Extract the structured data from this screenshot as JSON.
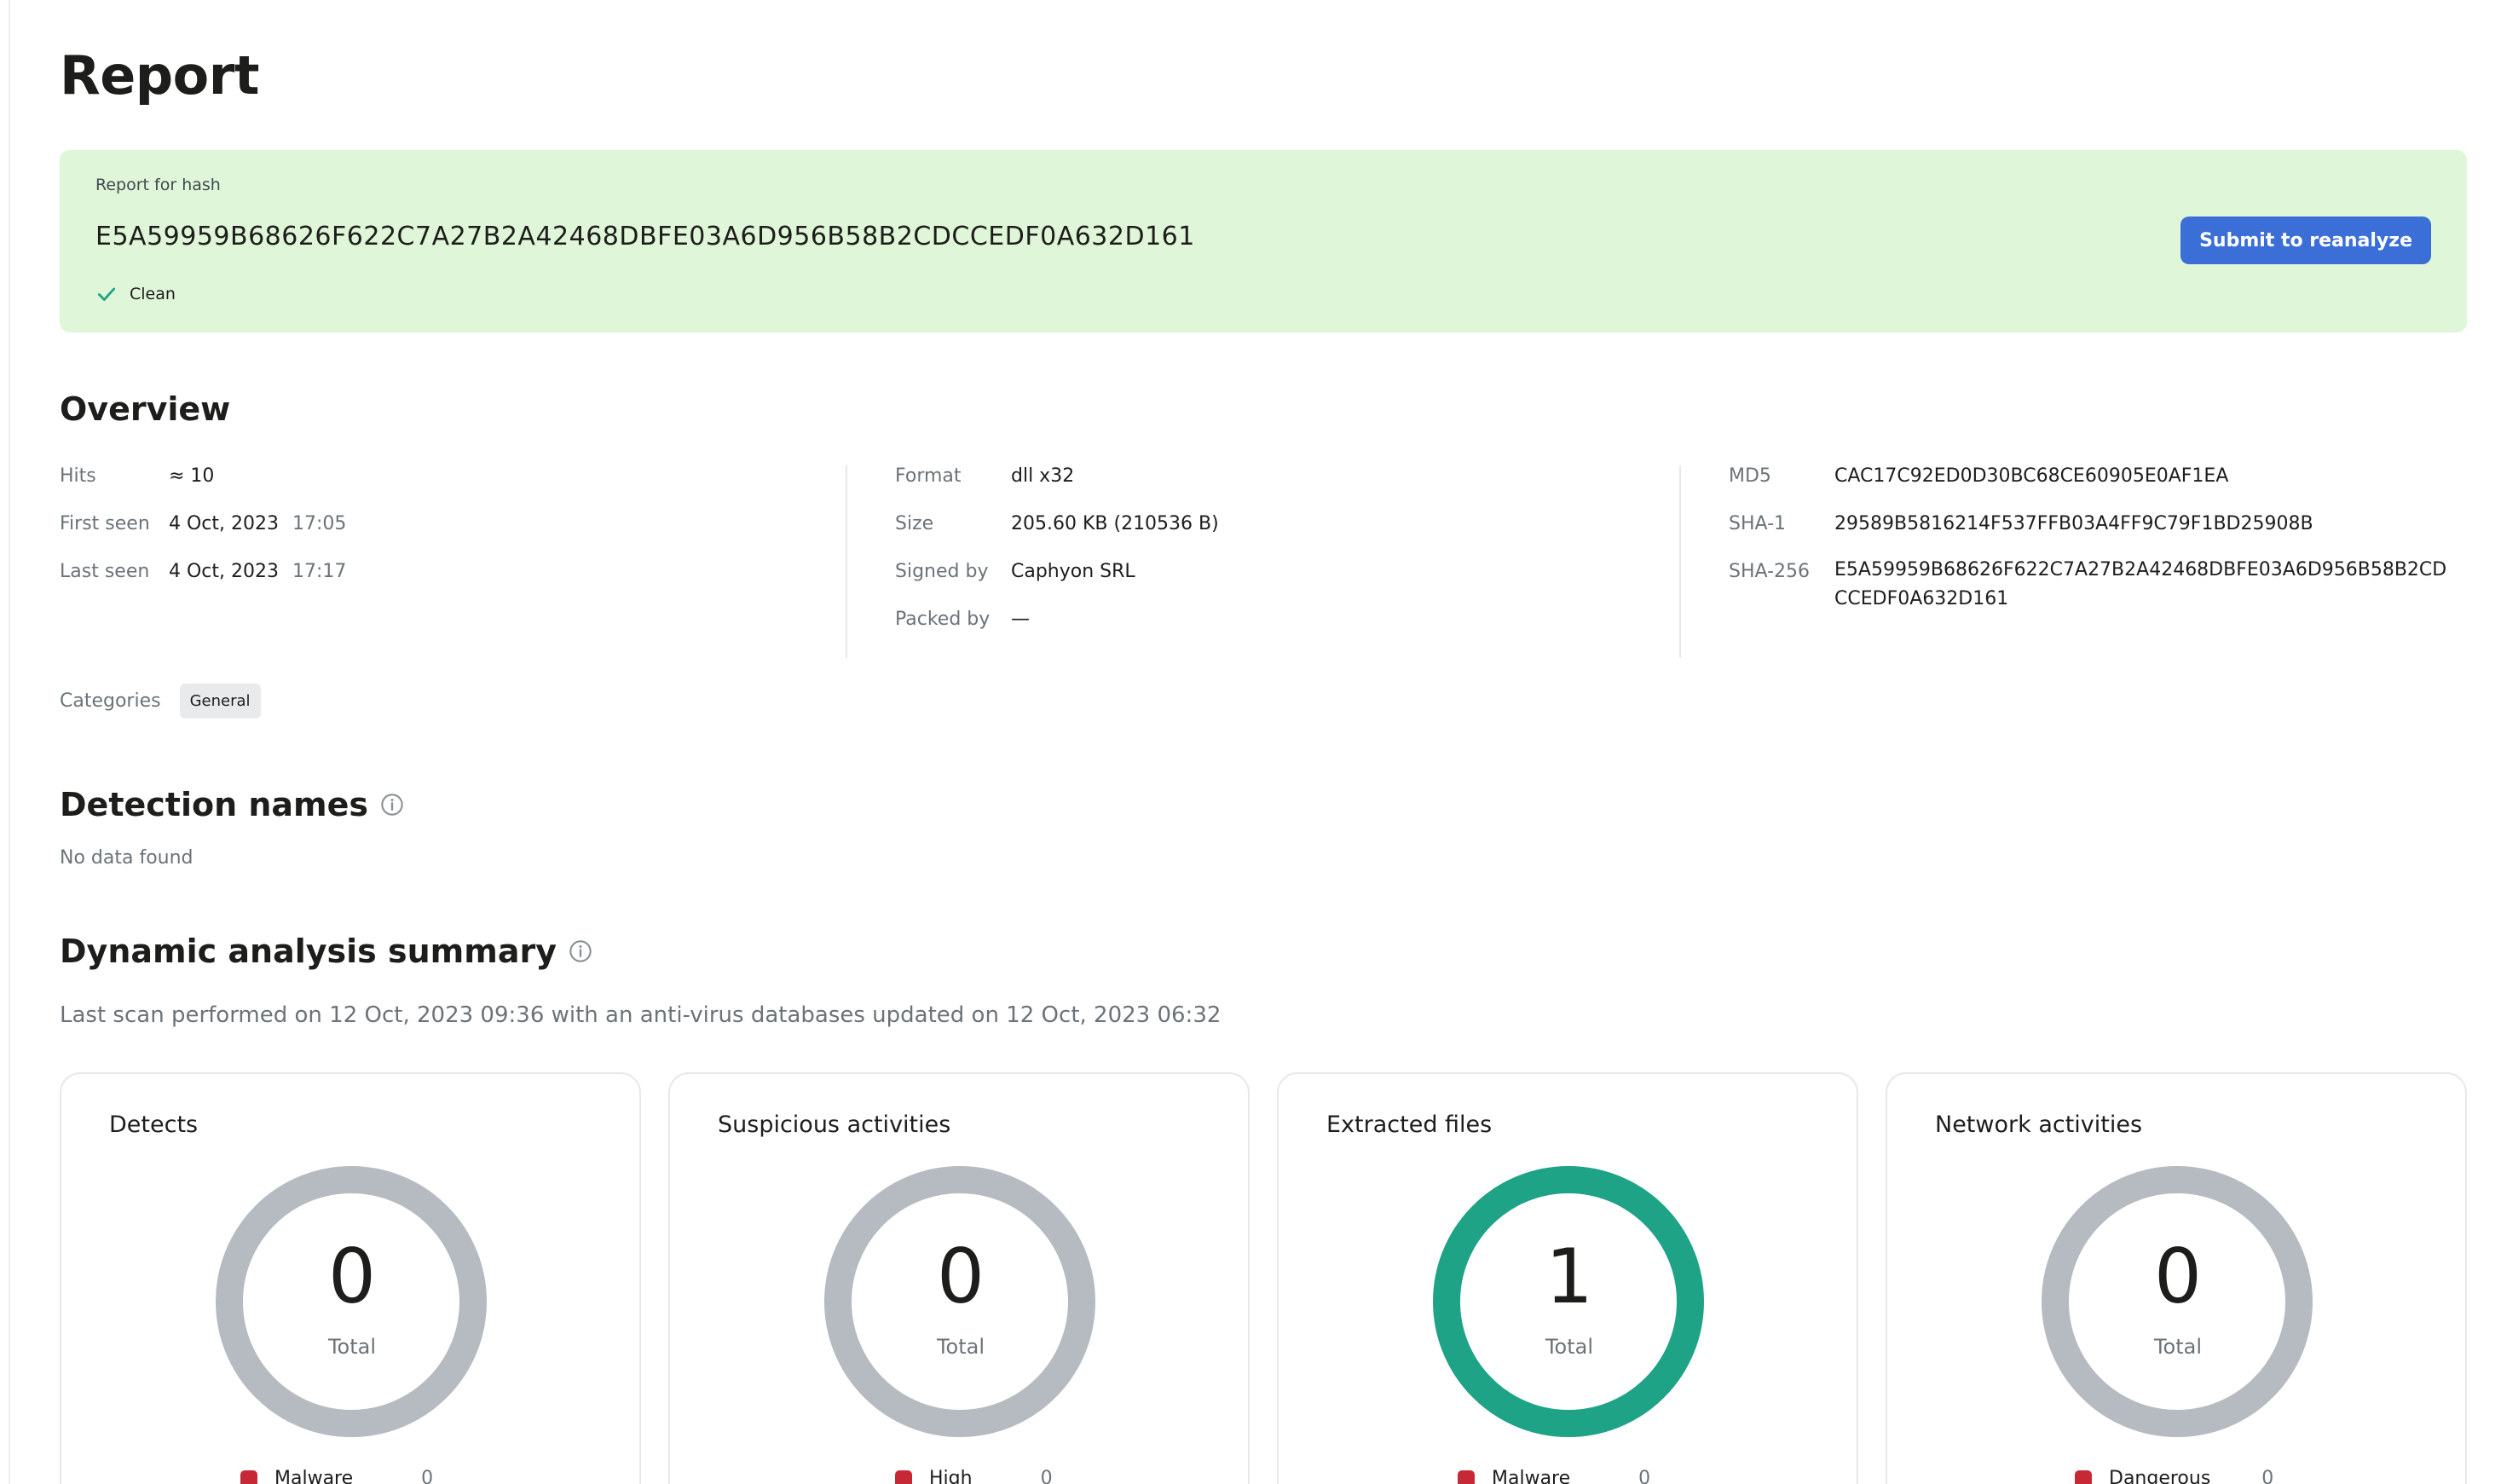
{
  "page": {
    "title": "Report"
  },
  "hash_banner": {
    "label": "Report for hash",
    "hash": "E5A59959B68626F622C7A27B2A42468DBFE03A6D956B58B2CDCCEDF0A632D161",
    "status": "Clean",
    "status_icon": "check-icon",
    "reanalyze_label": "Submit to reanalyze",
    "background_color": "#e0f6d8",
    "button_color": "#3b6fd7"
  },
  "overview": {
    "title": "Overview",
    "col1": [
      {
        "key": "Hits",
        "value": "≈ 10",
        "sub": ""
      },
      {
        "key": "First seen",
        "value": "4 Oct, 2023",
        "sub": "17:05"
      },
      {
        "key": "Last seen",
        "value": "4 Oct, 2023",
        "sub": "17:17"
      }
    ],
    "col2": [
      {
        "key": "Format",
        "value": "dll x32"
      },
      {
        "key": "Size",
        "value": "205.60 KB (210536 B)"
      },
      {
        "key": "Signed by",
        "value": "Caphyon SRL"
      },
      {
        "key": "Packed by",
        "value": "—"
      }
    ],
    "col3": [
      {
        "key": "MD5",
        "value": "CAC17C92ED0D30BC68CE60905E0AF1EA"
      },
      {
        "key": "SHA-1",
        "value": "29589B5816214F537FFB03A4FF9C79F1BD25908B"
      },
      {
        "key": "SHA-256",
        "value": "E5A59959B68626F622C7A27B2A42468DBFE03A6D956B58B2CDCCEDF0A632D161"
      }
    ],
    "categories_label": "Categories",
    "categories": [
      "General"
    ]
  },
  "detection_names": {
    "title": "Detection names",
    "empty_text": "No data found"
  },
  "dynamic_analysis": {
    "title": "Dynamic analysis summary",
    "scan_info": "Last scan performed on 12 Oct, 2023 09:36 with an anti-virus databases updated on 12 Oct, 2023 06:32",
    "cards": [
      {
        "title": "Detects",
        "value": "0",
        "label": "Total",
        "ring_color": "#b5bbc1",
        "legend": {
          "name": "Malware",
          "count": "0"
        }
      },
      {
        "title": "Suspicious activities",
        "value": "0",
        "label": "Total",
        "ring_color": "#b5bbc1",
        "legend": {
          "name": "High",
          "count": "0"
        }
      },
      {
        "title": "Extracted files",
        "value": "1",
        "label": "Total",
        "ring_color": "#1fa386",
        "legend": {
          "name": "Malware",
          "count": "0"
        }
      },
      {
        "title": "Network activities",
        "value": "0",
        "label": "Total",
        "ring_color": "#b5bbc1",
        "legend": {
          "name": "Dangerous",
          "count": "0"
        }
      }
    ]
  }
}
